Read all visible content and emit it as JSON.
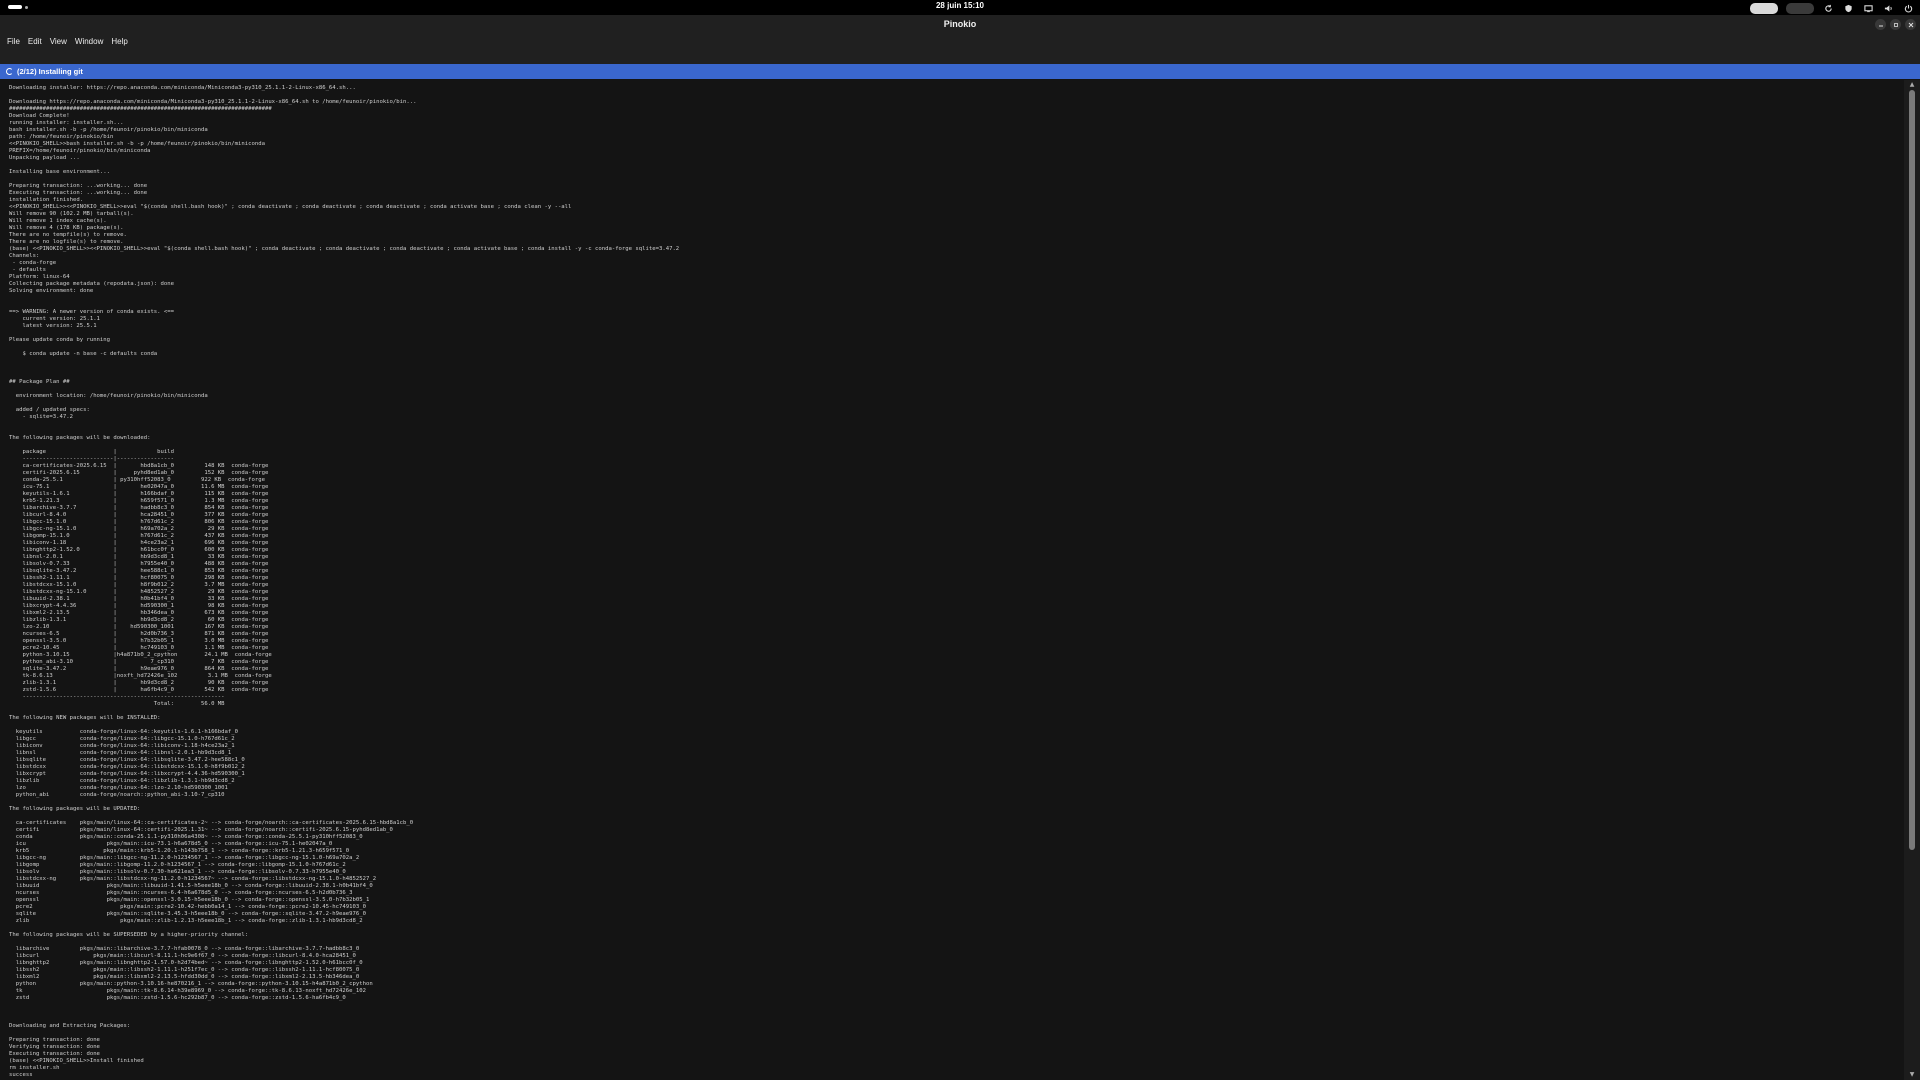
{
  "system_bar": {
    "clock": "28 juin 15:10"
  },
  "window": {
    "title": "Pinokio"
  },
  "menu": [
    "File",
    "Edit",
    "View",
    "Window",
    "Help"
  ],
  "status": {
    "text": "(2/12) Installing git"
  },
  "terminal": {
    "lines": [
      "Downloading installer: https://repo.anaconda.com/miniconda/Miniconda3-py310_25.1.1-2-Linux-x86_64.sh...",
      "",
      "Downloading https://repo.anaconda.com/miniconda/Miniconda3-py310_25.1.1-2-Linux-x86_64.sh to /home/feunoir/pinokio/bin...",
      "##############################################################################",
      "Download Complete!",
      "running installer: installer.sh...",
      "bash installer.sh -b -p /home/feunoir/pinokio/bin/miniconda",
      "path: /home/feunoir/pinokio/bin",
      "<<PINOKIO_SHELL>>bash installer.sh -b -p /home/feunoir/pinokio/bin/miniconda",
      "PREFIX=/home/feunoir/pinokio/bin/miniconda",
      "Unpacking payload ...",
      "",
      "Installing base environment...",
      "",
      "Preparing transaction: ...working... done",
      "Executing transaction: ...working... done",
      "installation finished.",
      "<<PINOKIO_SHELL>><<PINOKIO_SHELL>>eval \"$(conda shell.bash hook)\" ; conda deactivate ; conda deactivate ; conda deactivate ; conda activate base ; conda clean -y --all",
      "Will remove 90 (102.2 MB) tarball(s).",
      "Will remove 1 index cache(s).",
      "Will remove 4 (178 KB) package(s).",
      "There are no tempfile(s) to remove.",
      "There are no logfile(s) to remove.",
      "(base) <<PINOKIO_SHELL>><<PINOKIO_SHELL>>eval \"$(conda shell.bash hook)\" ; conda deactivate ; conda deactivate ; conda deactivate ; conda activate base ; conda install -y -c conda-forge sqlite=3.47.2",
      "Channels:",
      " - conda-forge",
      " - defaults",
      "Platform: linux-64",
      "Collecting package metadata (repodata.json): done",
      "Solving environment: done",
      "",
      "",
      "==> WARNING: A newer version of conda exists. <==",
      "    current version: 25.1.1",
      "    latest version: 25.5.1",
      "",
      "Please update conda by running",
      "",
      "    $ conda update -n base -c defaults conda",
      "",
      "",
      "",
      "## Package Plan ##",
      "",
      "  environment location: /home/feunoir/pinokio/bin/miniconda",
      "",
      "  added / updated specs:",
      "    - sqlite=3.47.2",
      "",
      "",
      "The following packages will be downloaded:",
      "",
      "    package                    |            build",
      "    ---------------------------|-----------------",
      "    ca-certificates-2025.6.15  |       hbd8a1cb_0         148 KB  conda-forge",
      "    certifi-2025.6.15          |     pyhd8ed1ab_0         152 KB  conda-forge",
      "    conda-25.5.1               | py310hff52083_0         922 KB  conda-forge",
      "    icu-75.1                   |       he02047a_0        11.6 MB  conda-forge",
      "    keyutils-1.6.1             |       h166bdaf_0         115 KB  conda-forge",
      "    krb5-1.21.3                |       h659f571_0         1.3 MB  conda-forge",
      "    libarchive-3.7.7           |       hadbb8c3_0         854 KB  conda-forge",
      "    libcurl-8.4.0              |       hca28451_0         377 KB  conda-forge",
      "    libgcc-15.1.0              |       h767d61c_2         806 KB  conda-forge",
      "    libgcc-ng-15.1.0           |       h69a702a_2          29 KB  conda-forge",
      "    libgomp-15.1.0             |       h767d61c_2         437 KB  conda-forge",
      "    libiconv-1.18              |       h4ce23a2_1         696 KB  conda-forge",
      "    libnghttp2-1.52.0          |       h61bcc0f_0         600 KB  conda-forge",
      "    libnsl-2.0.1               |       hb9d3cd8_1          33 KB  conda-forge",
      "    libsolv-0.7.33             |       h7955e40_0         488 KB  conda-forge",
      "    libsqlite-3.47.2           |       hee588c1_0         853 KB  conda-forge",
      "    libssh2-1.11.1             |       hcf80075_0         298 KB  conda-forge",
      "    libstdcxx-15.1.0           |       h8f9b012_2         3.7 MB  conda-forge",
      "    libstdcxx-ng-15.1.0        |       h4852527_2          29 KB  conda-forge",
      "    libuuid-2.38.1             |       h0b41bf4_0          33 KB  conda-forge",
      "    libxcrypt-4.4.36           |       hd590300_1          98 KB  conda-forge",
      "    libxml2-2.13.5             |       hb346dea_0         673 KB  conda-forge",
      "    libzlib-1.3.1              |       hb9d3cd8_2          60 KB  conda-forge",
      "    lzo-2.10                   |    hd590300_1001         167 KB  conda-forge",
      "    ncurses-6.5                |       h2d0b736_3         871 KB  conda-forge",
      "    openssl-3.5.0              |       h7b32b05_1         3.0 MB  conda-forge",
      "    pcre2-10.45                |       hc749103_0         1.1 MB  conda-forge",
      "    python-3.10.15             |h4a871b0_2_cpython        24.1 MB  conda-forge",
      "    python_abi-3.10            |          7_cp310           7 KB  conda-forge",
      "    sqlite-3.47.2              |       h9eae976_0         864 KB  conda-forge",
      "    tk-8.6.13                  |noxft_hd72426e_102         3.1 MB  conda-forge",
      "    zlib-1.3.1                 |       hb9d3cd8_2          90 KB  conda-forge",
      "    zstd-1.5.6                 |       ha6fb4c9_0         542 KB  conda-forge",
      "    ------------------------------------------------------------",
      "                                           Total:        56.0 MB",
      "",
      "The following NEW packages will be INSTALLED:",
      "",
      "  keyutils           conda-forge/linux-64::keyutils-1.6.1-h166bdaf_0",
      "  libgcc             conda-forge/linux-64::libgcc-15.1.0-h767d61c_2",
      "  libiconv           conda-forge/linux-64::libiconv-1.18-h4ce23a2_1",
      "  libnsl             conda-forge/linux-64::libnsl-2.0.1-hb9d3cd8_1",
      "  libsqlite          conda-forge/linux-64::libsqlite-3.47.2-hee588c1_0",
      "  libstdcxx          conda-forge/linux-64::libstdcxx-15.1.0-h8f9b012_2",
      "  libxcrypt          conda-forge/linux-64::libxcrypt-4.4.36-hd590300_1",
      "  libzlib            conda-forge/linux-64::libzlib-1.3.1-hb9d3cd8_2",
      "  lzo                conda-forge/linux-64::lzo-2.10-hd590300_1001",
      "  python_abi         conda-forge/noarch::python_abi-3.10-7_cp310",
      "",
      "The following packages will be UPDATED:",
      "",
      "  ca-certificates    pkgs/main/linux-64::ca-certificates-2~ --> conda-forge/noarch::ca-certificates-2025.6.15-hbd8a1cb_0",
      "  certifi            pkgs/main/linux-64::certifi-2025.1.31~ --> conda-forge/noarch::certifi-2025.6.15-pyhd8ed1ab_0",
      "  conda              pkgs/main::conda-25.1.1-py310h06a4308~ --> conda-forge::conda-25.5.1-py310hff52083_0",
      "  icu                        pkgs/main::icu-73.1-h6a678d5_0 --> conda-forge::icu-75.1-he02047a_0",
      "  krb5                      pkgs/main::krb5-1.20.1-h143b758_1 --> conda-forge::krb5-1.21.3-h659f571_0",
      "  libgcc-ng          pkgs/main::libgcc-ng-11.2.0-h1234567_1 --> conda-forge::libgcc-ng-15.1.0-h69a702a_2",
      "  libgomp            pkgs/main::libgomp-11.2.0-h1234567_1 --> conda-forge::libgomp-15.1.0-h767d61c_2",
      "  libsolv            pkgs/main::libsolv-0.7.30-he621ea3_1 --> conda-forge::libsolv-0.7.33-h7955e40_0",
      "  libstdcxx-ng       pkgs/main::libstdcxx-ng-11.2.0-h1234567~ --> conda-forge::libstdcxx-ng-15.1.0-h4852527_2",
      "  libuuid                    pkgs/main::libuuid-1.41.5-h5eee18b_0 --> conda-forge::libuuid-2.38.1-h0b41bf4_0",
      "  ncurses                    pkgs/main::ncurses-6.4-h6a678d5_0 --> conda-forge::ncurses-6.5-h2d0b736_3",
      "  openssl                    pkgs/main::openssl-3.0.15-h5eee18b_0 --> conda-forge::openssl-3.5.0-h7b32b05_1",
      "  pcre2                          pkgs/main::pcre2-10.42-hebb0a14_1 --> conda-forge::pcre2-10.45-hc749103_0",
      "  sqlite                     pkgs/main::sqlite-3.45.3-h5eee18b_0 --> conda-forge::sqlite-3.47.2-h9eae976_0",
      "  zlib                           pkgs/main::zlib-1.2.13-h5eee18b_1 --> conda-forge::zlib-1.3.1-hb9d3cd8_2",
      "",
      "The following packages will be SUPERSEDED by a higher-priority channel:",
      "",
      "  libarchive         pkgs/main::libarchive-3.7.7-hfab0078_0 --> conda-forge::libarchive-3.7.7-hadbb8c3_0",
      "  libcurl                pkgs/main::libcurl-8.11.1-hc9e6f67_0 --> conda-forge::libcurl-8.4.0-hca28451_0",
      "  libnghttp2         pkgs/main::libnghttp2-1.57.0-h2d74bed~ --> conda-forge::libnghttp2-1.52.0-h61bcc0f_0",
      "  libssh2                pkgs/main::libssh2-1.11.1-h251f7ec_0 --> conda-forge::libssh2-1.11.1-hcf80075_0",
      "  libxml2                pkgs/main::libxml2-2.13.5-hfdd30dd_0 --> conda-forge::libxml2-2.13.5-hb346dea_0",
      "  python             pkgs/main::python-3.10.16-he870216_1 --> conda-forge::python-3.10.15-h4a871b0_2_cpython",
      "  tk                         pkgs/main::tk-8.6.14-h39e8969_0 --> conda-forge::tk-8.6.13-noxft_hd72426e_102",
      "  zstd                       pkgs/main::zstd-1.5.6-hc292b87_0 --> conda-forge::zstd-1.5.6-ha6fb4c9_0",
      "",
      "",
      "",
      "Downloading and Extracting Packages:",
      "",
      "Preparing transaction: done",
      "Verifying transaction: done",
      "Executing transaction: done",
      "(base) <<PINOKIO_SHELL>>Install finished",
      "rm installer.sh",
      "success"
    ]
  }
}
